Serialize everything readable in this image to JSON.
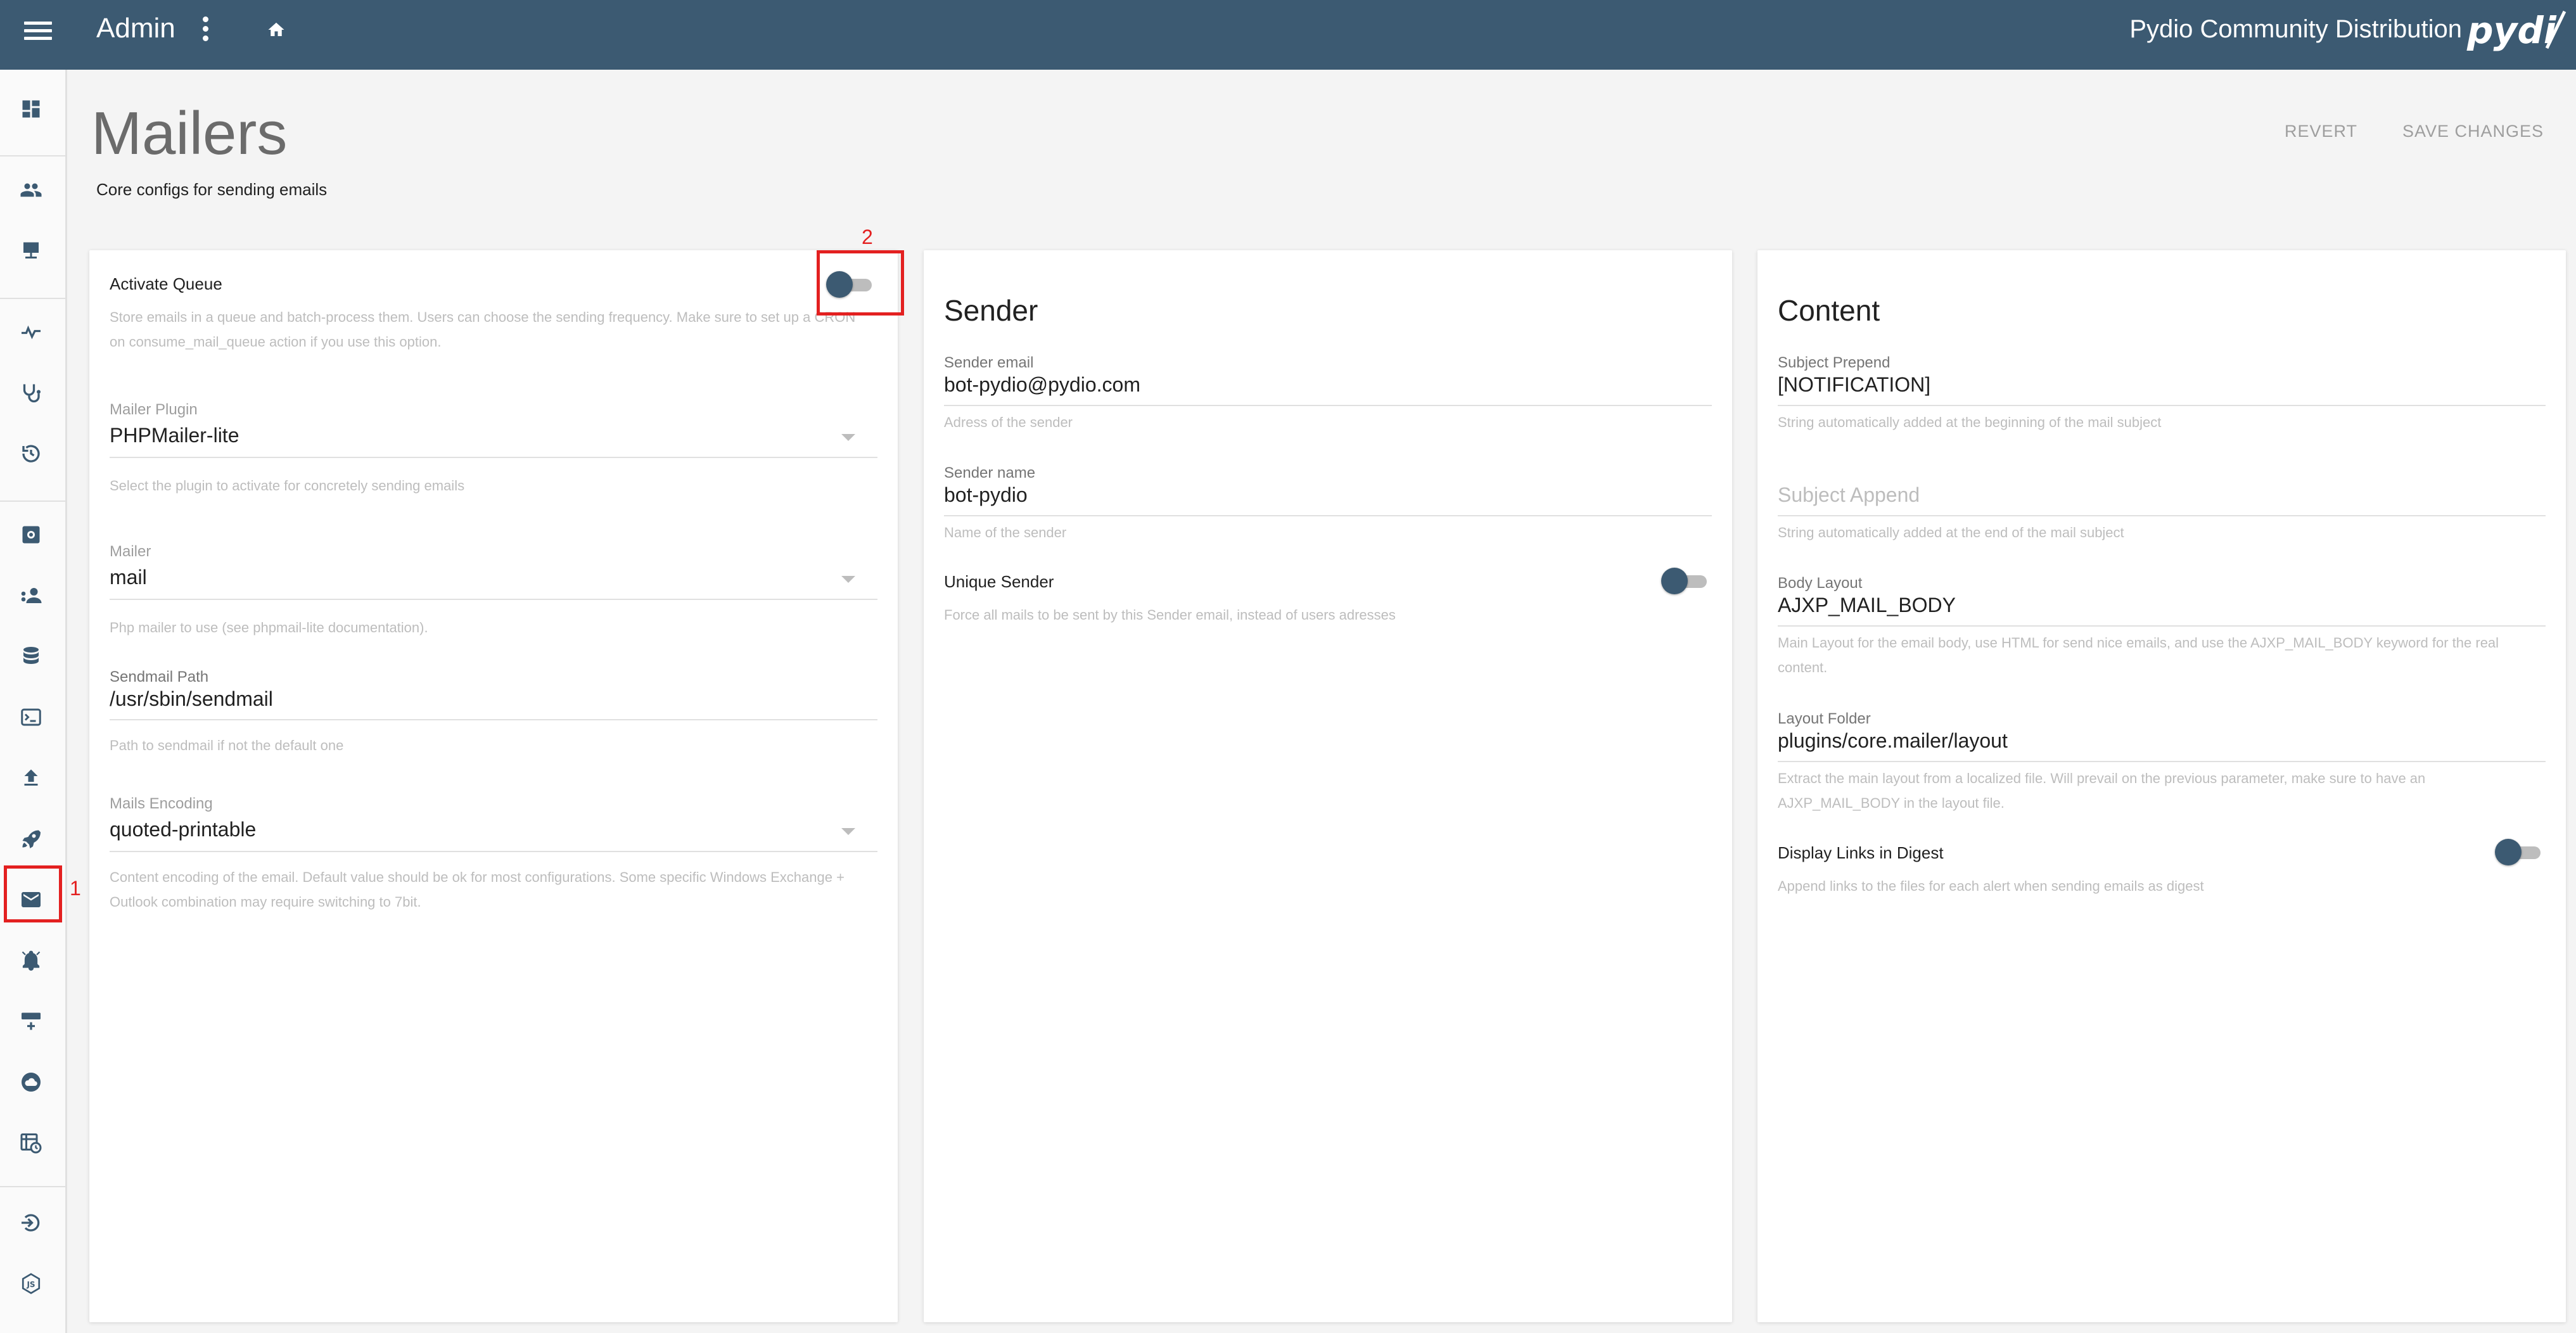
{
  "topbar": {
    "title": "Admin",
    "brand_name": "Pydio Community Distribution",
    "brand_color": "#3c5a72"
  },
  "sidebar": {
    "items": [
      {
        "icon": "dashboard-icon"
      },
      {
        "icon": "users-icon"
      },
      {
        "icon": "workspaces-icon"
      },
      {
        "icon": "activity-icon"
      },
      {
        "icon": "diagnostic-icon"
      },
      {
        "icon": "history-icon"
      },
      {
        "icon": "settings-icon"
      },
      {
        "icon": "user-settings-icon"
      },
      {
        "icon": "datasource-icon"
      },
      {
        "icon": "terminal-icon"
      },
      {
        "icon": "upload-icon"
      },
      {
        "icon": "rocket-icon"
      },
      {
        "icon": "mail-icon",
        "active": true
      },
      {
        "icon": "alarm-icon"
      },
      {
        "icon": "server-icon"
      },
      {
        "icon": "cloud-icon"
      },
      {
        "icon": "scheduler-icon"
      },
      {
        "icon": "login-icon"
      },
      {
        "icon": "developer-icon"
      }
    ]
  },
  "page": {
    "title": "Mailers",
    "subtitle": "Core configs for sending emails",
    "revert_label": "REVERT",
    "save_label": "SAVE CHANGES"
  },
  "annotations": {
    "marker_1": "1",
    "marker_2": "2",
    "highlight_color": "#e32020"
  },
  "queue_card": {
    "activate_queue": {
      "label": "Activate Queue",
      "enabled": false,
      "help": "Store emails in a queue and batch-process them. Users can choose the sending frequency. Make sure to set up a CRON on consume_mail_queue action if you use this option."
    },
    "mailer_plugin": {
      "label": "Mailer Plugin",
      "value": "PHPMailer-lite",
      "help": "Select the plugin to activate for concretely sending emails"
    },
    "mailer": {
      "label": "Mailer",
      "value": "mail",
      "help": "Php mailer to use (see phpmail-lite documentation)."
    },
    "sendmail_path": {
      "label": "Sendmail Path",
      "value": "/usr/sbin/sendmail",
      "help": "Path to sendmail if not the default one"
    },
    "mails_encoding": {
      "label": "Mails Encoding",
      "value": "quoted-printable",
      "help": "Content encoding of the email. Default value should be ok for most configurations. Some specific Windows Exchange + Outlook combination may require switching to 7bit."
    }
  },
  "sender_card": {
    "title": "Sender",
    "sender_email": {
      "label": "Sender email",
      "value": "bot-pydio@pydio.com",
      "help": "Adress of the sender"
    },
    "sender_name": {
      "label": "Sender name",
      "value": "bot-pydio",
      "help": "Name of the sender"
    },
    "unique_sender": {
      "label": "Unique Sender",
      "enabled": false,
      "help": "Force all mails to be sent by this Sender email, instead of users adresses"
    }
  },
  "content_card": {
    "title": "Content",
    "subject_prepend": {
      "label": "Subject Prepend",
      "value": "[NOTIFICATION]",
      "help": "String automatically added at the beginning of the mail subject"
    },
    "subject_append": {
      "placeholder": "Subject Append",
      "help": "String automatically added at the end of the mail subject"
    },
    "body_layout": {
      "label": "Body Layout",
      "value": "AJXP_MAIL_BODY",
      "help": "Main Layout for the email body, use HTML for send nice emails, and use the AJXP_MAIL_BODY keyword for the real content."
    },
    "layout_folder": {
      "label": "Layout Folder",
      "value": "plugins/core.mailer/layout",
      "help": "Extract the main layout from a localized file. Will prevail on the previous parameter, make sure to have an AJXP_MAIL_BODY in the layout file."
    },
    "display_links": {
      "label": "Display Links in Digest",
      "enabled": false,
      "help": "Append links to the files for each alert when sending emails as digest"
    }
  }
}
